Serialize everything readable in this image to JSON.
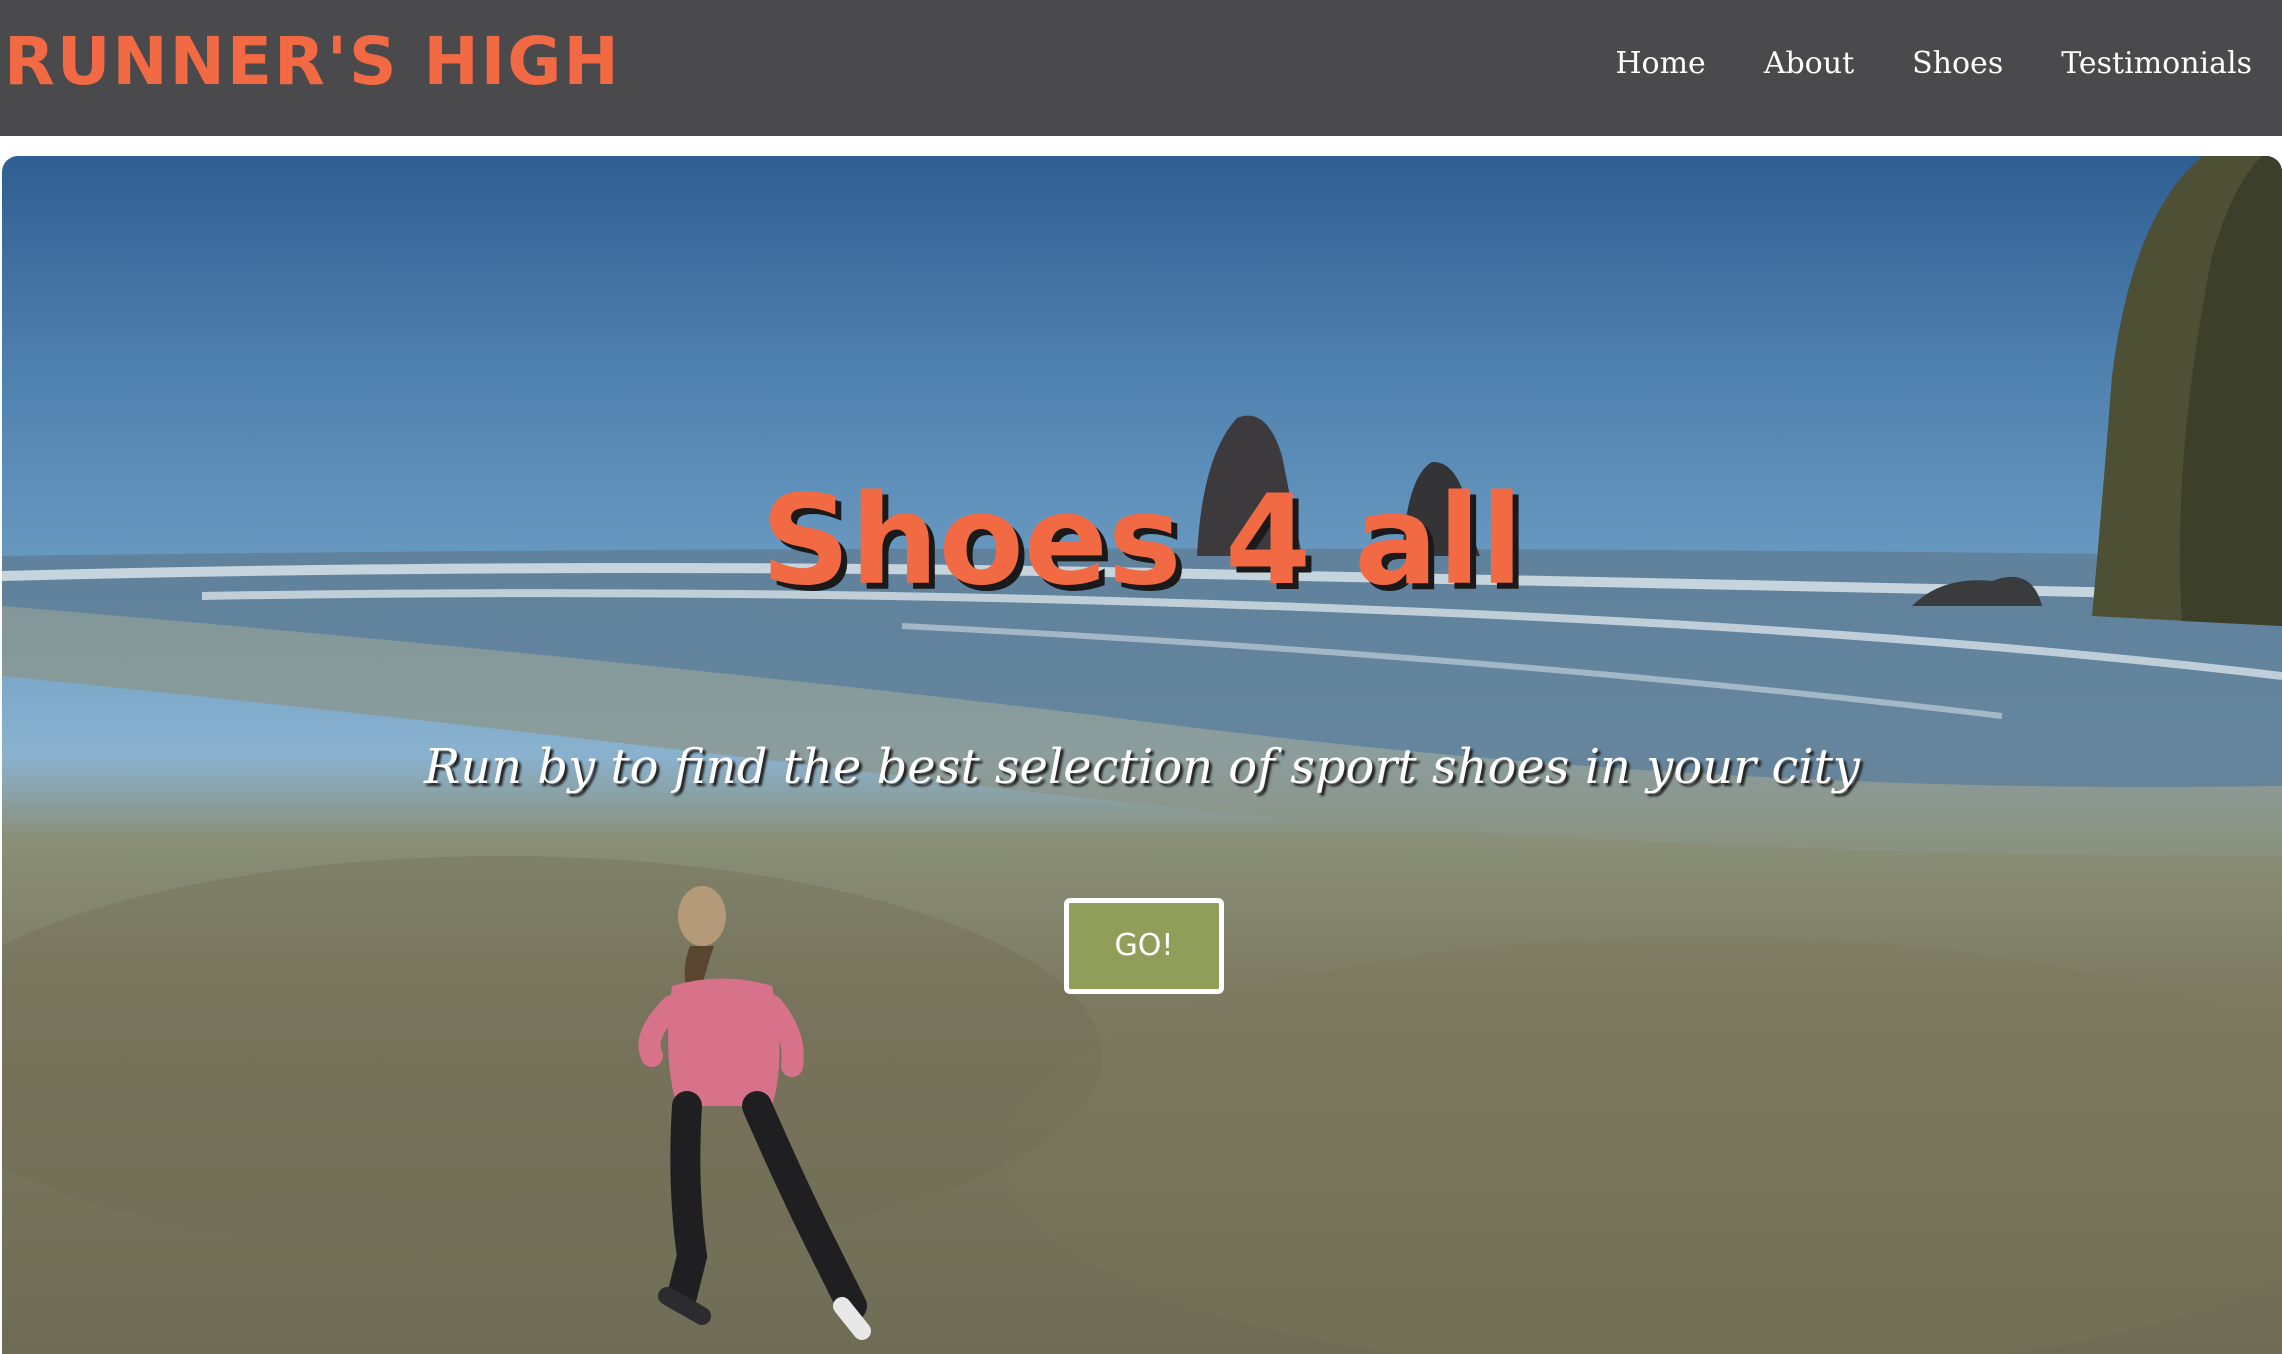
{
  "navbar": {
    "brand": "RUNNER'S HIGH",
    "links": [
      {
        "label": "Home"
      },
      {
        "label": "About"
      },
      {
        "label": "Shoes"
      },
      {
        "label": "Testimonials"
      }
    ]
  },
  "hero": {
    "title": "Shoes 4 all",
    "subtitle": "Run by to find the best selection of sport shoes in your city",
    "button_label": "GO!"
  },
  "colors": {
    "accent": "#f26a43",
    "navbar_bg": "#4a4a4d",
    "button_bg": "#8f9f5a"
  }
}
